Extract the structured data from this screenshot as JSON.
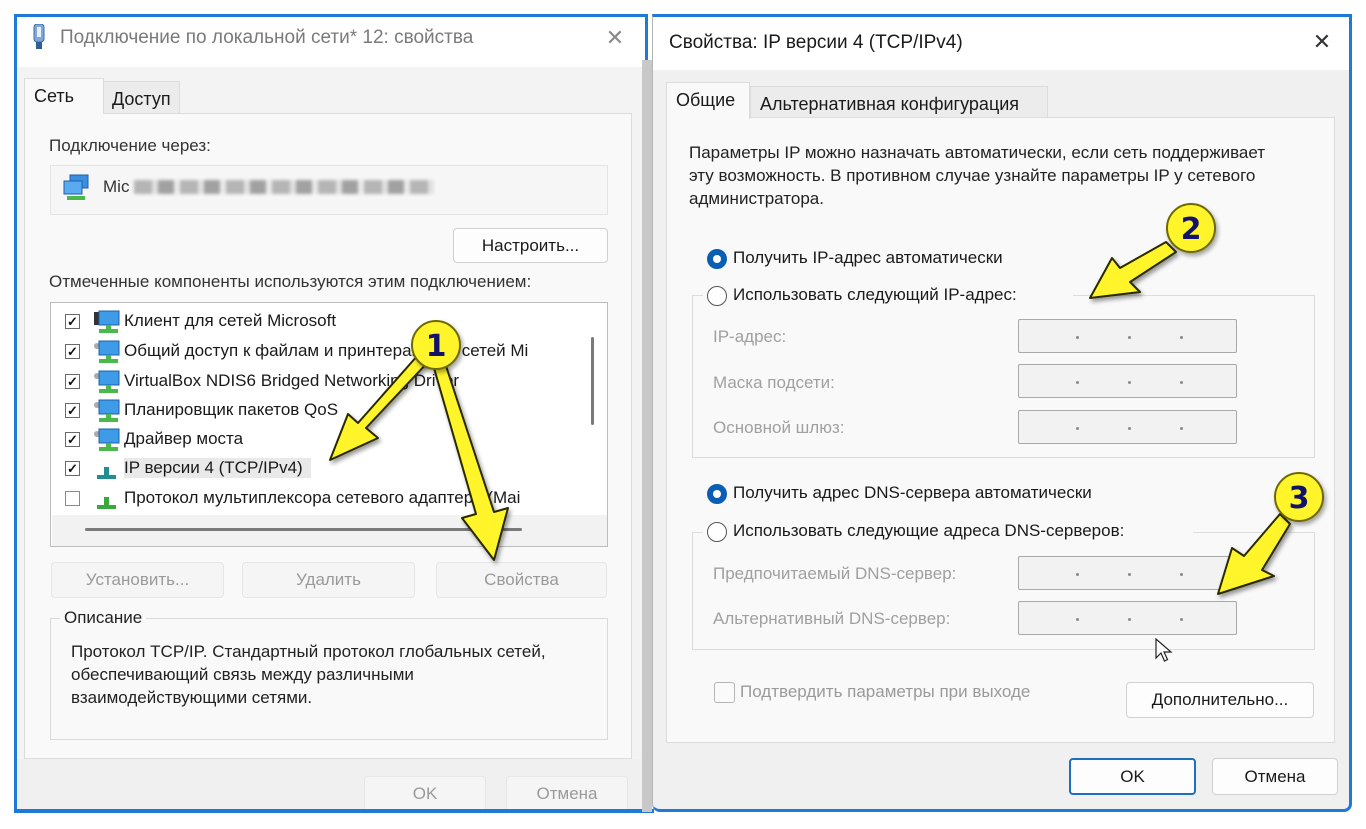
{
  "left_dialog": {
    "title": "Подключение по локальной сети* 12: свойства",
    "close_label": "✕",
    "tabs": [
      {
        "label": "Сеть",
        "active": true
      },
      {
        "label": "Доступ",
        "active": false
      }
    ],
    "connect_via_label": "Подключение через:",
    "adapter_name_visible": "Mic",
    "configure_button": "Настроить...",
    "components_label": "Отмеченные компоненты используются этим подключением:",
    "components": [
      {
        "label": "Клиент для сетей Microsoft",
        "checked": true,
        "icon": "network-client-icon"
      },
      {
        "label": "Общий доступ к файлам и принтерам для сетей Mi",
        "checked": true,
        "icon": "network-service-icon"
      },
      {
        "label": "VirtualBox NDIS6 Bridged Networking Driver",
        "checked": true,
        "icon": "network-service-icon"
      },
      {
        "label": "Планировщик пакетов QoS",
        "checked": true,
        "icon": "network-service-icon"
      },
      {
        "label": "Драйвер моста",
        "checked": true,
        "icon": "network-service-icon"
      },
      {
        "label": "IP версии 4 (TCP/IPv4)",
        "checked": true,
        "icon": "protocol-icon",
        "selected": true
      },
      {
        "label": "Протокол мультиплексора сетевого адаптера (Mai",
        "checked": false,
        "icon": "protocol-icon"
      }
    ],
    "install_button": "Установить...",
    "remove_button": "Удалить",
    "properties_button": "Свойства",
    "description_title": "Описание",
    "description_text": "Протокол TCP/IP. Стандартный протокол глобальных сетей, обеспечивающий связь между различными взаимодействующими сетями.",
    "ok_button": "OK",
    "cancel_button": "Отмена"
  },
  "right_dialog": {
    "title": "Свойства: IP версии 4 (TCP/IPv4)",
    "close_label": "✕",
    "tabs": [
      {
        "label": "Общие",
        "active": true
      },
      {
        "label": "Альтернативная конфигурация",
        "active": false
      }
    ],
    "intro_text": "Параметры IP можно назначать автоматически, если сеть поддерживает эту возможность. В противном случае узнайте параметры IP у сетевого администратора.",
    "ip_auto_label": "Получить IP-адрес автоматически",
    "ip_auto_selected": true,
    "ip_manual_label": "Использовать следующий IP-адрес:",
    "ip_fields": [
      {
        "label": "IP-адрес:",
        "value": ""
      },
      {
        "label": "Маска подсети:",
        "value": ""
      },
      {
        "label": "Основной шлюз:",
        "value": ""
      }
    ],
    "dns_auto_label": "Получить адрес DNS-сервера автоматически",
    "dns_auto_selected": true,
    "dns_manual_label": "Использовать следующие адреса DNS-серверов:",
    "dns_fields": [
      {
        "label": "Предпочитаемый DNS-сервер:",
        "value": ""
      },
      {
        "label": "Альтернативный DNS-сервер:",
        "value": ""
      }
    ],
    "confirm_label": "Подтвердить параметры при выходе",
    "confirm_checked": false,
    "advanced_button": "Дополнительно...",
    "ok_button": "OK",
    "cancel_button": "Отмена"
  },
  "annotations": {
    "badges": [
      "1",
      "2",
      "3"
    ],
    "arrow_color": "#fff52a",
    "badge_text_color": "#12126b"
  },
  "colors": {
    "window_border": "#1e7ad6",
    "radio_selected": "#0a5fb4"
  }
}
